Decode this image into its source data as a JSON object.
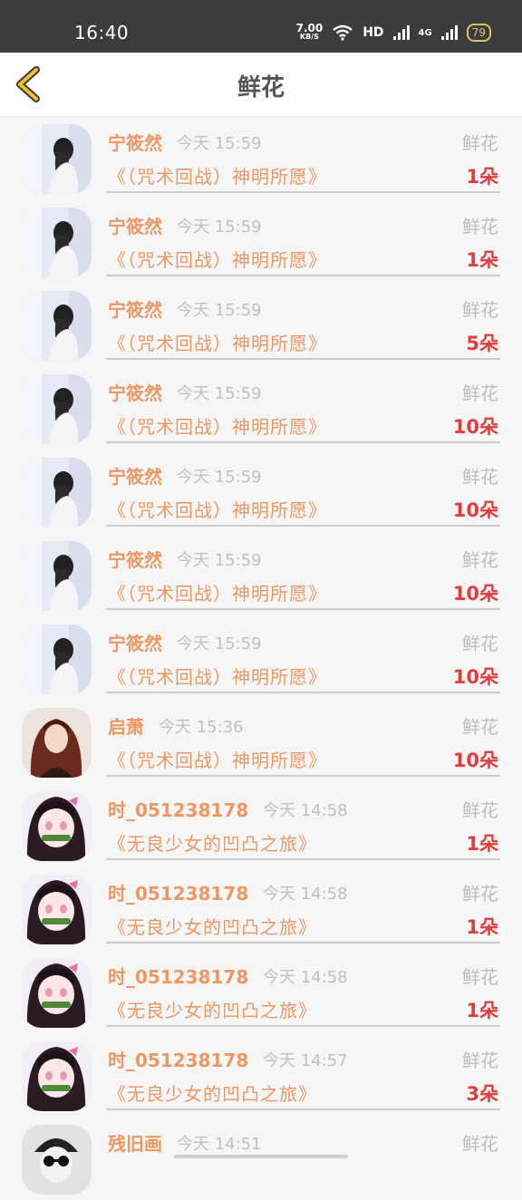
{
  "status_bar": {
    "time": "16:40",
    "net_speed_value": "7.00",
    "net_speed_unit": "KB/S",
    "hd_label": "HD",
    "network_label": "4G",
    "battery": "79"
  },
  "header": {
    "title": "鲜花",
    "accent_color": "#f0c02b"
  },
  "colors": {
    "name": "#ee9762",
    "count": "#e23d3d",
    "muted": "#c0c0c0"
  },
  "records": [
    {
      "name": "宁筱然",
      "time": "今天 15:59",
      "gift": "鲜花",
      "book": "《（咒术回战）神明所愿》",
      "count": "1朵",
      "avatar": "girl-window-avatar"
    },
    {
      "name": "宁筱然",
      "time": "今天 15:59",
      "gift": "鲜花",
      "book": "《（咒术回战）神明所愿》",
      "count": "1朵",
      "avatar": "girl-window-avatar"
    },
    {
      "name": "宁筱然",
      "time": "今天 15:59",
      "gift": "鲜花",
      "book": "《（咒术回战）神明所愿》",
      "count": "5朵",
      "avatar": "girl-window-avatar"
    },
    {
      "name": "宁筱然",
      "time": "今天 15:59",
      "gift": "鲜花",
      "book": "《（咒术回战）神明所愿》",
      "count": "10朵",
      "avatar": "girl-window-avatar"
    },
    {
      "name": "宁筱然",
      "time": "今天 15:59",
      "gift": "鲜花",
      "book": "《（咒术回战）神明所愿》",
      "count": "10朵",
      "avatar": "girl-window-avatar"
    },
    {
      "name": "宁筱然",
      "time": "今天 15:59",
      "gift": "鲜花",
      "book": "《（咒术回战）神明所愿》",
      "count": "10朵",
      "avatar": "girl-window-avatar"
    },
    {
      "name": "宁筱然",
      "time": "今天 15:59",
      "gift": "鲜花",
      "book": "《（咒术回战）神明所愿》",
      "count": "10朵",
      "avatar": "girl-window-avatar"
    },
    {
      "name": "启萧",
      "time": "今天 15:36",
      "gift": "鲜花",
      "book": "《（咒术回战）神明所愿》",
      "count": "10朵",
      "avatar": "redhair-avatar"
    },
    {
      "name": "时_051238178",
      "time": "今天 14:58",
      "gift": "鲜花",
      "book": "《无良少女的凹凸之旅》",
      "count": "1朵",
      "avatar": "anime-girl-avatar"
    },
    {
      "name": "时_051238178",
      "time": "今天 14:58",
      "gift": "鲜花",
      "book": "《无良少女的凹凸之旅》",
      "count": "1朵",
      "avatar": "anime-girl-avatar"
    },
    {
      "name": "时_051238178",
      "time": "今天 14:58",
      "gift": "鲜花",
      "book": "《无良少女的凹凸之旅》",
      "count": "1朵",
      "avatar": "anime-girl-avatar"
    },
    {
      "name": "时_051238178",
      "time": "今天 14:57",
      "gift": "鲜花",
      "book": "《无良少女的凹凸之旅》",
      "count": "3朵",
      "avatar": "anime-girl-avatar"
    },
    {
      "name": "残旧画",
      "time": "今天 14:51",
      "gift": "鲜花",
      "book": "",
      "count": "",
      "avatar": "sunglasses-avatar"
    }
  ]
}
